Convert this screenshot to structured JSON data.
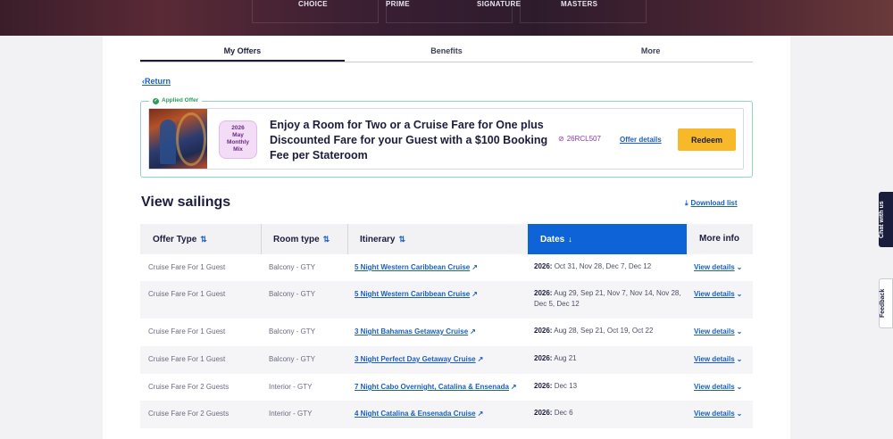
{
  "hero": {
    "tiers": [
      "CHOICE",
      "PRIME",
      "SIGNATURE",
      "MASTERS"
    ]
  },
  "tabs": [
    {
      "label": "My Offers",
      "active": true
    },
    {
      "label": "Benefits",
      "active": false
    },
    {
      "label": "More",
      "active": false
    }
  ],
  "return_label": "Return",
  "offer": {
    "applied_label": "Applied Offer",
    "badge_lines": [
      "2026",
      "May",
      "Monthly",
      "Mix"
    ],
    "title": "Enjoy a Room for Two or a Cruise Fare for One plus Discounted Fare for your Guest with a $100 Booking Fee per Stateroom",
    "promo_code": "26RCL507",
    "details_label": "Offer details",
    "redeem_label": "Redeem"
  },
  "sailings": {
    "title": "View sailings",
    "download_label": "Download list",
    "columns": [
      {
        "label": "Offer Type",
        "sortable": true,
        "active": false
      },
      {
        "label": "Room type",
        "sortable": true,
        "active": false
      },
      {
        "label": "Itinerary",
        "sortable": true,
        "active": false
      },
      {
        "label": "Dates",
        "sortable": true,
        "active": true
      },
      {
        "label": "More info",
        "sortable": false,
        "active": false
      }
    ],
    "rows": [
      {
        "offer_type": "Cruise Fare For 1 Guest",
        "room_type": "Balcony - GTY",
        "itinerary": "5 Night Western Caribbean Cruise",
        "year": "2026:",
        "dates": "Oct 31, Nov 28, Dec 7, Dec 12",
        "more": "View details"
      },
      {
        "offer_type": "Cruise Fare For 1 Guest",
        "room_type": "Balcony - GTY",
        "itinerary": "5 Night Western Caribbean Cruise",
        "year": "2026:",
        "dates": "Aug 29, Sep 21, Nov 7, Nov 14, Nov 28, Dec 5, Dec 12",
        "more": "View details"
      },
      {
        "offer_type": "Cruise Fare For 1 Guest",
        "room_type": "Balcony - GTY",
        "itinerary": "3 Night Bahamas Getaway Cruise",
        "year": "2026:",
        "dates": "Aug 28, Sep 21, Oct 19, Oct 22",
        "more": "View details"
      },
      {
        "offer_type": "Cruise Fare For 1 Guest",
        "room_type": "Balcony - GTY",
        "itinerary": "3 Night Perfect Day Getaway Cruise",
        "year": "2026:",
        "dates": "Aug 21",
        "more": "View details"
      },
      {
        "offer_type": "Cruise Fare For 2 Guests",
        "room_type": "Interior - GTY",
        "itinerary": "7 Night Cabo Overnight, Catalina & Ensenada",
        "year": "2026:",
        "dates": "Dec 13",
        "more": "View details"
      },
      {
        "offer_type": "Cruise Fare For 2 Guests",
        "room_type": "Interior - GTY",
        "itinerary": "4 Night Catalina & Ensenada Cruise",
        "year": "2026:",
        "dates": "Dec 6",
        "more": "View details"
      }
    ]
  },
  "side": {
    "chat_label": "Chat with us",
    "feedback_label": "Feedback"
  }
}
